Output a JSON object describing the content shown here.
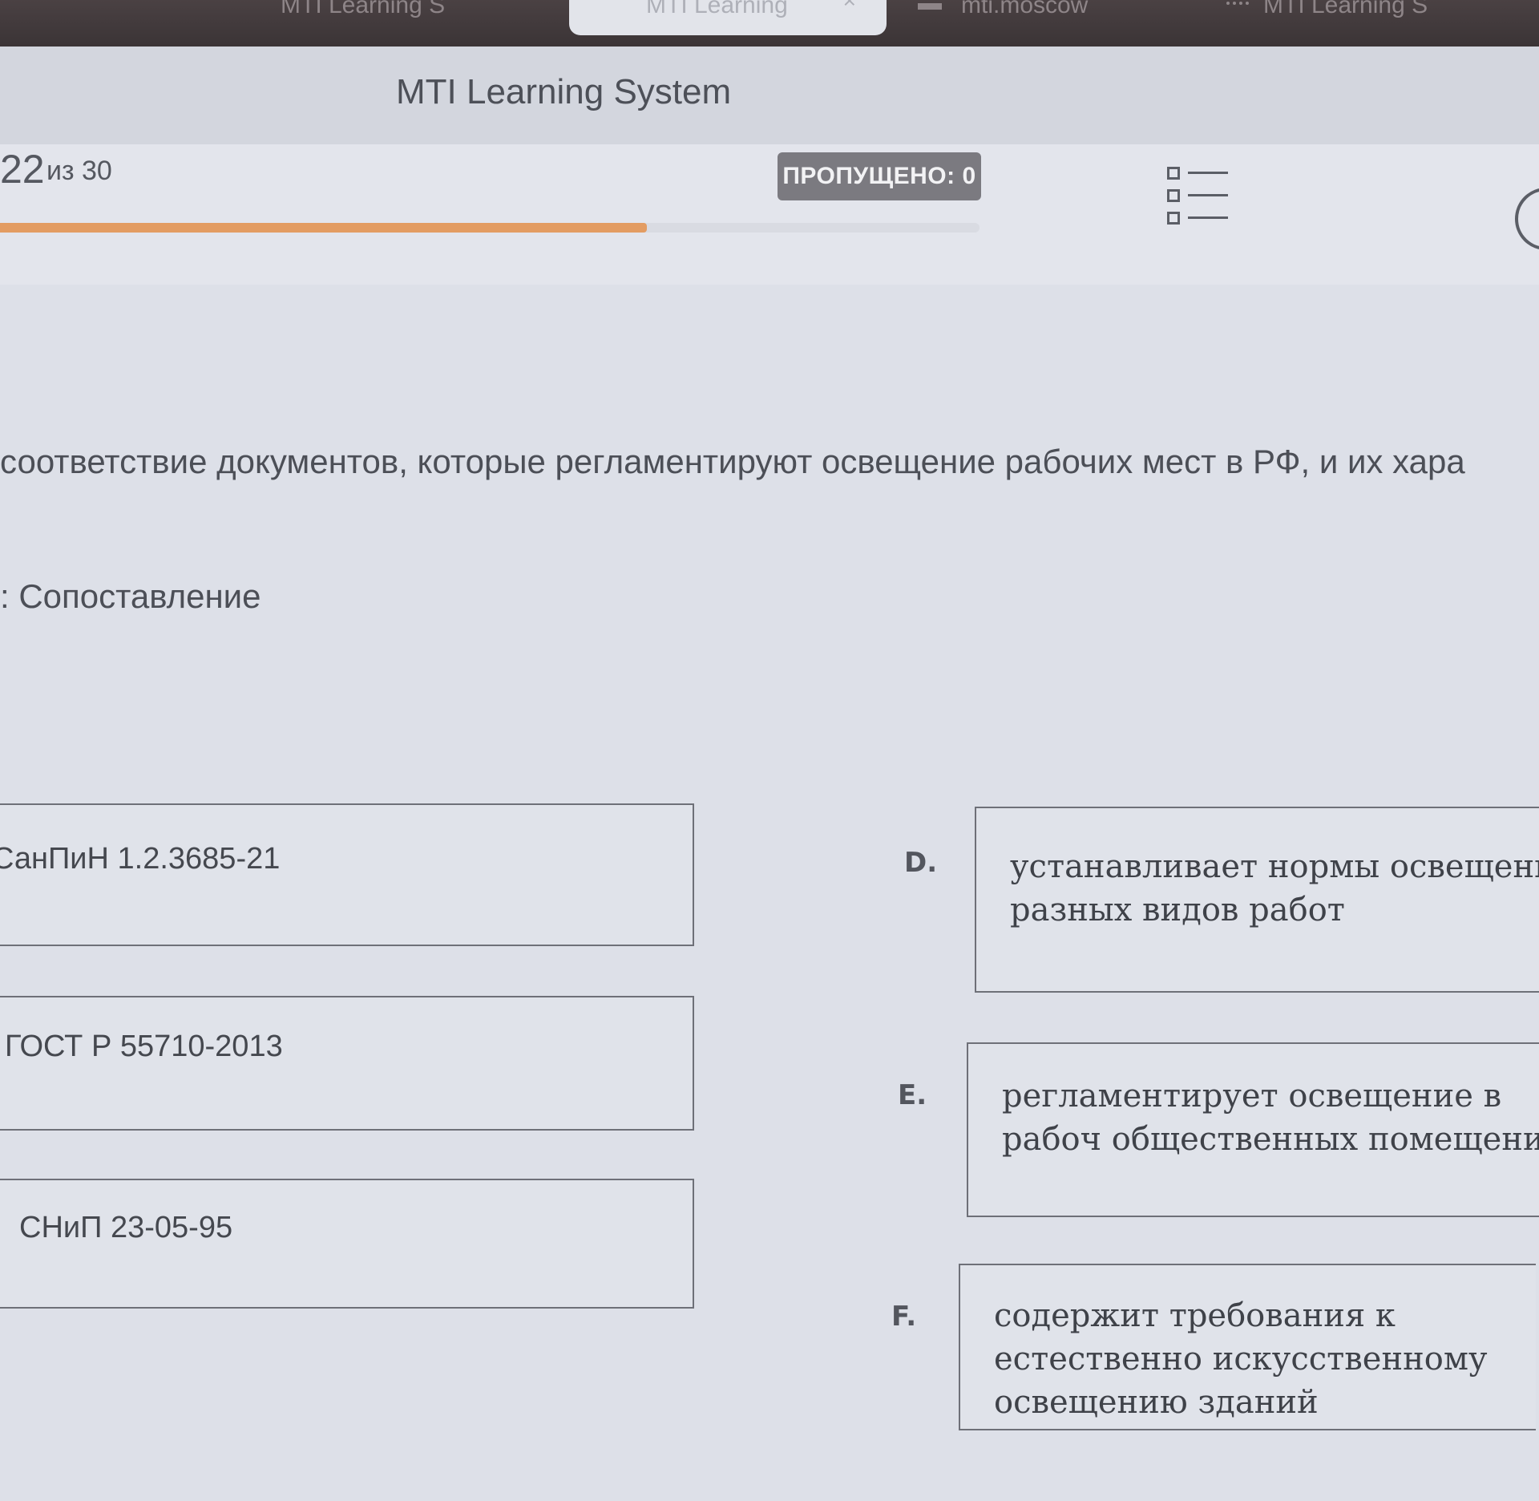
{
  "browser": {
    "tabs": [
      {
        "label": "MTI Learning S",
        "active": false
      },
      {
        "label": "MTI Learning",
        "active": true,
        "close": "×"
      },
      {
        "label": "mti.moscow",
        "active": false
      },
      {
        "label": "MTI Learning S",
        "active": false
      }
    ]
  },
  "header": {
    "title": "MTI Learning System"
  },
  "progress": {
    "current": "22",
    "of_label": "из 30",
    "fraction": 0.66,
    "fill_color": "#e39c62"
  },
  "skipped": {
    "label": "ПРОПУЩЕНО: 0"
  },
  "icons": {
    "list": "list-icon",
    "timer": "clock-icon"
  },
  "question": {
    "text": "соответствие документов, которые регламентируют освещение рабочих мест в РФ, и их хара",
    "type_label": ": Сопоставление"
  },
  "matching": {
    "left": [
      {
        "label": "СанПиН 1.2.3685-21"
      },
      {
        "label": "ГОСТ Р 55710-2013"
      },
      {
        "label": "СНиП 23-05-95"
      }
    ],
    "right": [
      {
        "letter": "D.",
        "text": "устанавливает нормы освещения разных видов работ"
      },
      {
        "letter": "E.",
        "text": "регламентирует освещение в рабоч общественных помещениях"
      },
      {
        "letter": "F.",
        "text": "содержит требования к естественно искусственному освещению зданий"
      }
    ]
  }
}
